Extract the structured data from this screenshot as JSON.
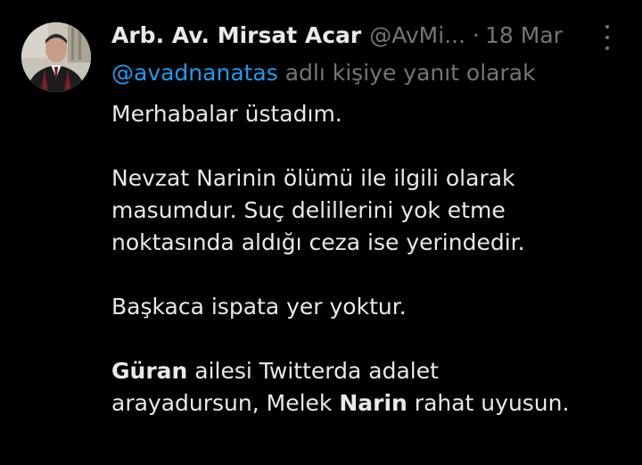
{
  "tweet": {
    "display_name": "Arb. Av. Mirsat Acar",
    "handle": "@AvMi...",
    "dot": "·",
    "date": "18 Mar",
    "more_icon": "more-vertical-icon",
    "reply_to": {
      "mention": "@avadnanatas",
      "suffix": " adlı kişiye yanıt olarak"
    },
    "body": {
      "p1": "Merhabalar üstadım.",
      "p2_line1": "Nevzat Narinin ölümü ile ilgili olarak",
      "p2_line2": "masumdur. Suç delillerini yok etme",
      "p2_line3": "noktasında aldığı ceza ise yerindedir.",
      "p3": "Başkaca ispata yer yoktur.",
      "p4_bold1": "Güran",
      "p4_text1": " ailesi Twitterda adalet",
      "p4_text2": "arayadursun, Melek ",
      "p4_bold2": "Narin",
      "p4_text3": " rahat uyusun."
    }
  },
  "colors": {
    "background": "#000000",
    "primary_text": "#e7e9ea",
    "secondary_text": "#71767b",
    "link": "#1d9bf0"
  }
}
